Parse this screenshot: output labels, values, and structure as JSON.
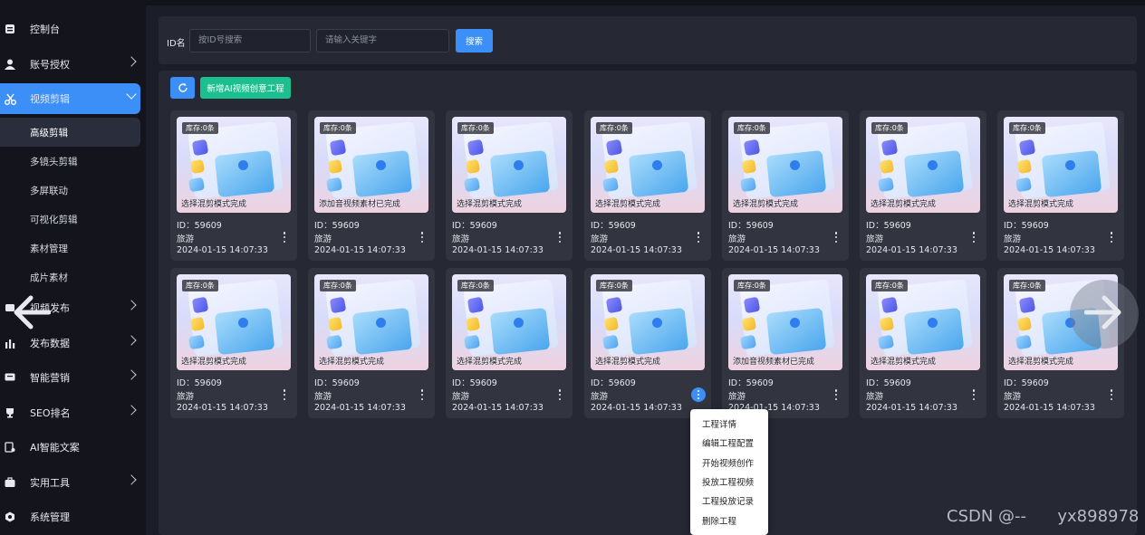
{
  "sidebar": {
    "items": [
      {
        "label": "控制台",
        "icon": "dashboard-icon"
      },
      {
        "label": "账号授权",
        "icon": "user-key-icon"
      },
      {
        "label": "视频剪辑",
        "icon": "scissors-icon"
      },
      {
        "label": "视频发布",
        "icon": "publish-icon"
      },
      {
        "label": "发布数据",
        "icon": "bar-chart-icon"
      },
      {
        "label": "智能营销",
        "icon": "marketing-icon"
      },
      {
        "label": "SEO排名",
        "icon": "trophy-icon"
      },
      {
        "label": "AI智能文案",
        "icon": "ai-doc-icon"
      },
      {
        "label": "实用工具",
        "icon": "toolbox-icon"
      },
      {
        "label": "系统管理",
        "icon": "settings-icon"
      }
    ],
    "sub_items": [
      {
        "label": "高级剪辑"
      },
      {
        "label": "多镜头剪辑"
      },
      {
        "label": "多屏联动"
      },
      {
        "label": "可视化剪辑"
      },
      {
        "label": "素材管理"
      },
      {
        "label": "成片素材"
      }
    ]
  },
  "filter": {
    "id_label": "ID名",
    "id_placeholder": "按ID号搜索",
    "keyword_placeholder": "请输入关键字",
    "search_label": "搜索"
  },
  "toolbar": {
    "create_label": "新增AI视频创意工程"
  },
  "cards": [
    {
      "stock": "库存:0条",
      "status": "选择混剪模式完成",
      "id": "ID：59609",
      "category": "旅游",
      "time": "2024-01-15 14:07:33"
    },
    {
      "stock": "库存:0条",
      "status": "添加音视频素材已完成",
      "id": "ID：59609",
      "category": "旅游",
      "time": "2024-01-15 14:07:33"
    },
    {
      "stock": "库存:0条",
      "status": "选择混剪模式完成",
      "id": "ID：59609",
      "category": "旅游",
      "time": "2024-01-15 14:07:33"
    },
    {
      "stock": "库存:0条",
      "status": "选择混剪模式完成",
      "id": "ID：59609",
      "category": "旅游",
      "time": "2024-01-15 14:07:33"
    },
    {
      "stock": "库存:0条",
      "status": "选择混剪模式完成",
      "id": "ID：59609",
      "category": "旅游",
      "time": "2024-01-15 14:07:33"
    },
    {
      "stock": "库存:0条",
      "status": "选择混剪模式完成",
      "id": "ID：59609",
      "category": "旅游",
      "time": "2024-01-15 14:07:33"
    },
    {
      "stock": "库存:0条",
      "status": "选择混剪模式完成",
      "id": "ID：59609",
      "category": "旅游",
      "time": "2024-01-15 14:07:33"
    },
    {
      "stock": "库存:0条",
      "status": "选择混剪模式完成",
      "id": "ID：59609",
      "category": "旅游",
      "time": "2024-01-15 14:07:33"
    },
    {
      "stock": "库存:0条",
      "status": "选择混剪模式完成",
      "id": "ID：59609",
      "category": "旅游",
      "time": "2024-01-15 14:07:33"
    },
    {
      "stock": "库存:0条",
      "status": "选择混剪模式完成",
      "id": "ID：59609",
      "category": "旅游",
      "time": "2024-01-15 14:07:33"
    },
    {
      "stock": "库存:0条",
      "status": "选择混剪模式完成",
      "id": "ID：59609",
      "category": "旅游",
      "time": "2024-01-15 14:07:33"
    },
    {
      "stock": "库存:0条",
      "status": "添加音视频素材已完成",
      "id": "ID：59609",
      "category": "旅游",
      "time": "2024-01-15 14:07:33"
    },
    {
      "stock": "库存:0条",
      "status": "选择混剪模式完成",
      "id": "ID：59609",
      "category": "旅游",
      "time": "2024-01-15 14:07:33"
    },
    {
      "stock": "库存:0条",
      "status": "选择混剪模式完成",
      "id": "ID：59609",
      "category": "旅游",
      "time": "2024-01-15 14:07:33"
    }
  ],
  "context_menu": {
    "items": [
      "工程详情",
      "编辑工程配置",
      "开始视频创作",
      "投放工程视频",
      "工程投放记录",
      "删除工程"
    ]
  },
  "watermark": "CSDN @--      yx898978",
  "colors": {
    "accent": "#3b8ff7",
    "create": "#1cbf8e",
    "sidebar": "#13141c",
    "panel": "#262834"
  }
}
